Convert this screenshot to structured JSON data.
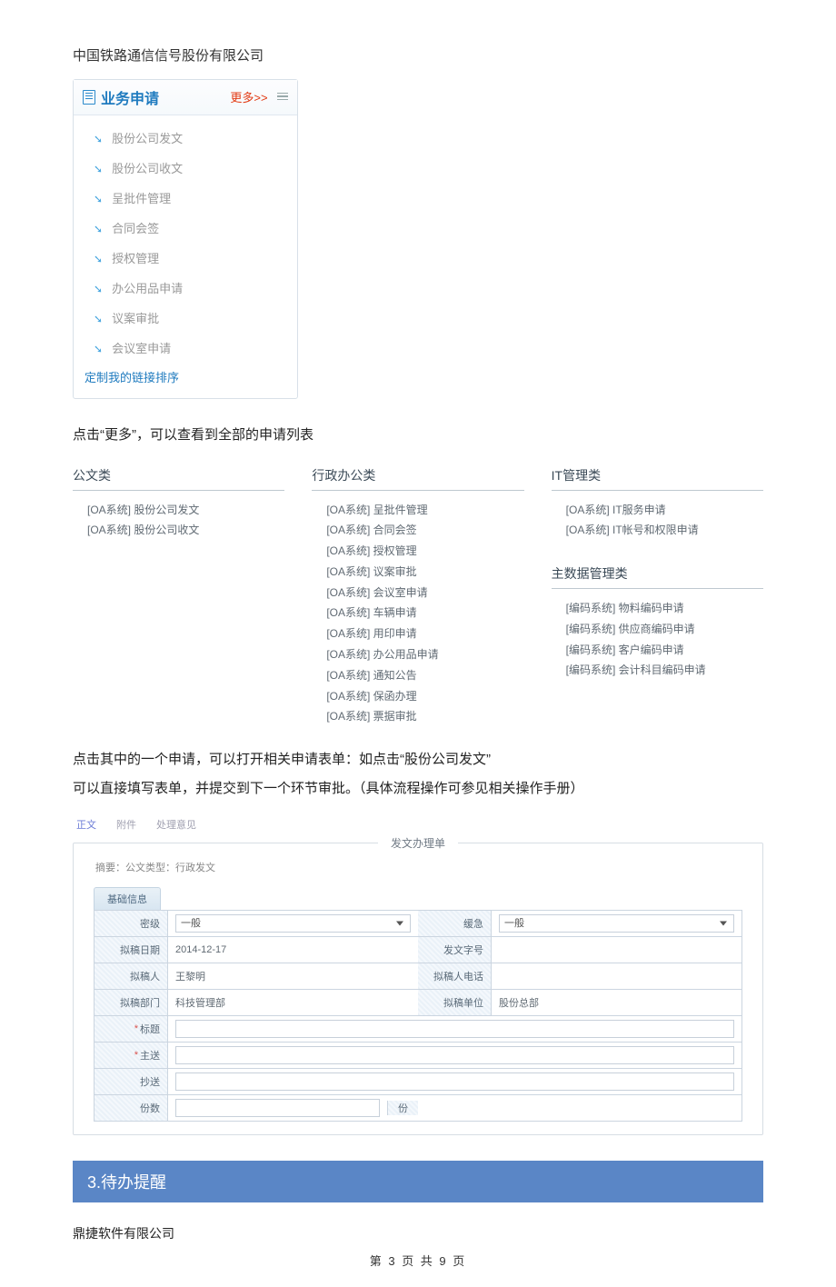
{
  "header": {
    "company_top": "中国铁路通信信号股份有限公司"
  },
  "sidebar": {
    "title": "业务申请",
    "more": "更多>>",
    "items": [
      {
        "label": "股份公司发文"
      },
      {
        "label": "股份公司收文"
      },
      {
        "label": "呈批件管理"
      },
      {
        "label": "合同会签"
      },
      {
        "label": "授权管理"
      },
      {
        "label": "办公用品申请"
      },
      {
        "label": "议案审批"
      },
      {
        "label": "会议室申请"
      }
    ],
    "customize": "定制我的链接排序"
  },
  "para1": "点击“更多”，可以查看到全部的申请列表",
  "categories": {
    "col1": {
      "title": "公文类",
      "items": [
        "[OA系统] 股份公司发文",
        "[OA系统] 股份公司收文"
      ]
    },
    "col2": {
      "title": "行政办公类",
      "items": [
        "[OA系统] 呈批件管理",
        "[OA系统] 合同会签",
        "[OA系统] 授权管理",
        "[OA系统] 议案审批",
        "[OA系统] 会议室申请",
        "[OA系统] 车辆申请",
        "[OA系统] 用印申请",
        "[OA系统] 办公用品申请",
        "[OA系统] 通知公告",
        "[OA系统] 保函办理",
        "[OA系统] 票据审批"
      ]
    },
    "col3a": {
      "title": "IT管理类",
      "items": [
        "[OA系统] IT服务申请",
        "[OA系统] IT帐号和权限申请"
      ]
    },
    "col3b": {
      "title": "主数据管理类",
      "items": [
        "[编码系统] 物料编码申请",
        "[编码系统] 供应商编码申请",
        "[编码系统] 客户编码申请",
        "[编码系统] 会计科目编码申请"
      ]
    }
  },
  "para2a": "点击其中的一个申请，可以打开相关申请表单：如点击“股份公司发文”",
  "para2b": "可以直接填写表单，并提交到下一个环节审批。（具体流程操作可参见相关操作手册）",
  "form": {
    "tabs": {
      "main": "正文",
      "attach": "附件",
      "opinion": "处理意见"
    },
    "legend": "发文办理单",
    "summary": "摘要：公文类型：行政发文",
    "section": "基础信息",
    "labels": {
      "secret": "密级",
      "urgent": "缓急",
      "draft_date": "拟稿日期",
      "doc_no": "发文字号",
      "drafter": "拟稿人",
      "phone": "拟稿人电话",
      "dept": "拟稿部门",
      "unit": "拟稿单位",
      "title": "标题",
      "main_send": "主送",
      "cc": "抄送",
      "copies": "份数",
      "copies_unit": "份"
    },
    "values": {
      "secret": "一般",
      "urgent": "一般",
      "draft_date": "2014-12-17",
      "doc_no": "",
      "drafter": "王黎明",
      "phone": "",
      "dept": "科技管理部",
      "unit": "股份总部",
      "title": "",
      "main_send": "",
      "cc": "",
      "copies": ""
    }
  },
  "section3": "3.待办提醒",
  "footer": {
    "company": "鼎捷软件有限公司",
    "pager": "第 3 页 共 9 页"
  }
}
